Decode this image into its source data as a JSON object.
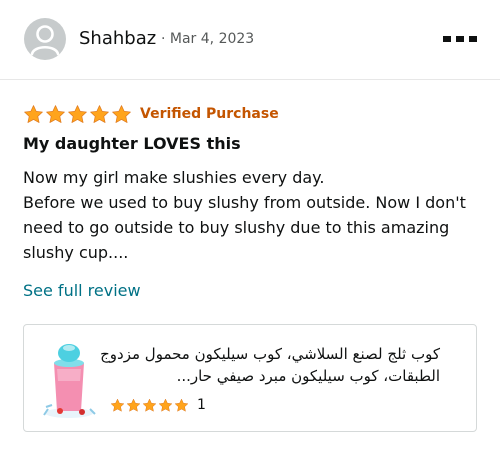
{
  "review": {
    "reviewer_name": "Shahbaz",
    "date": "· Mar 4, 2023",
    "rating": 5,
    "verified_label": "Verified Purchase",
    "title": "My daughter LOVES this",
    "body": "Now my girl make slushies every day.\nBefore we used to buy slushy from outside. Now I don't need to go outside to buy slushy due to this amazing slushy cup....",
    "see_full_label": "See full review"
  },
  "product": {
    "name": "كوب ثلج لصنع السلاشي، كوب سيليكون محمول مزدوج الطبقات، كوب سيليكون مبرد صيفي حار...",
    "rating": 5,
    "rating_count": "1"
  },
  "icons": {
    "avatar": "user-avatar-icon",
    "menu": "more-options-icon",
    "star": "star-icon"
  },
  "colors": {
    "star": "#ffa41c",
    "verified": "#c45500",
    "link": "#007185",
    "avatar_bg": "#c7cbcc"
  }
}
